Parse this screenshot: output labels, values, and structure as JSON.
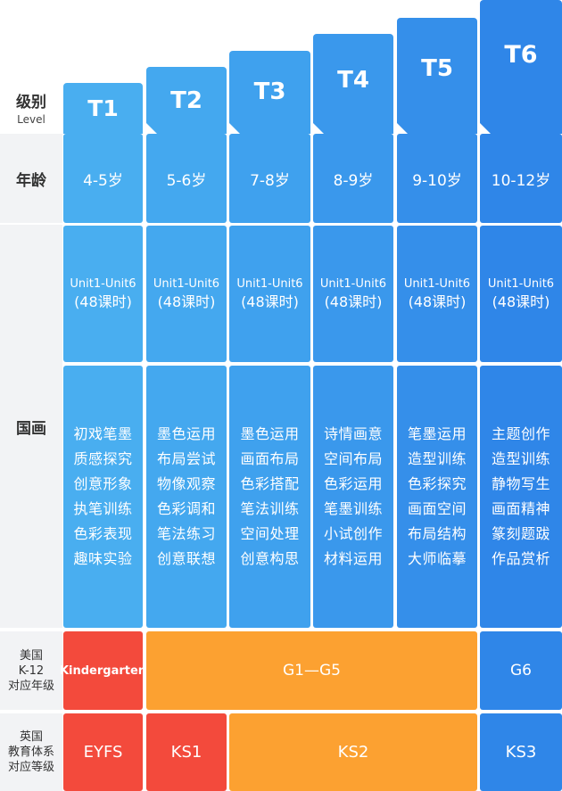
{
  "header": {
    "level_zh": "级别",
    "level_en": "Level",
    "tiers": [
      "T1",
      "T2",
      "T3",
      "T4",
      "T5",
      "T6"
    ]
  },
  "age": {
    "label": "年龄",
    "values": [
      "4-5岁",
      "5-6岁",
      "7-8岁",
      "8-9岁",
      "9-10岁",
      "10-12岁"
    ]
  },
  "guohua": {
    "label": "国画",
    "units": [
      {
        "line1": "Unit1-Unit6",
        "line2": "(48课时)"
      },
      {
        "line1": "Unit1-Unit6",
        "line2": "(48课时)"
      },
      {
        "line1": "Unit1-Unit6",
        "line2": "(48课时)"
      },
      {
        "line1": "Unit1-Unit6",
        "line2": "(48课时)"
      },
      {
        "line1": "Unit1-Unit6",
        "line2": "(48课时)"
      },
      {
        "line1": "Unit1-Unit6",
        "line2": "(48课时)"
      }
    ],
    "topics": [
      [
        "初戏笔墨",
        "质感探究",
        "创意形象",
        "执笔训练",
        "色彩表现",
        "趣味实验"
      ],
      [
        "墨色运用",
        "布局尝试",
        "物像观察",
        "色彩调和",
        "笔法练习",
        "创意联想"
      ],
      [
        "墨色运用",
        "画面布局",
        "色彩搭配",
        "笔法训练",
        "空间处理",
        "创意构思"
      ],
      [
        "诗情画意",
        "空间布局",
        "色彩运用",
        "笔墨训练",
        "小试创作",
        "材料运用"
      ],
      [
        "笔墨运用",
        "造型训练",
        "色彩探究",
        "画面空间",
        "布局结构",
        "大师临摹"
      ],
      [
        "主题创作",
        "造型训练",
        "静物写生",
        "画面精神",
        "篆刻题跋",
        "作品赏析"
      ]
    ]
  },
  "us": {
    "label_lines": [
      "美国",
      "K-12",
      "对应年级"
    ],
    "segments": [
      "Kindergarten",
      "G1—G5",
      "G6"
    ]
  },
  "uk": {
    "label_lines": [
      "英国",
      "教育体系",
      "对应等级"
    ],
    "segments": [
      "EYFS",
      "KS1",
      "KS2",
      "KS3"
    ]
  },
  "colors": {
    "blue_light": "#49aef0",
    "blue_dark": "#2c7fe8",
    "red": "#f34a3c",
    "orange": "#fca131",
    "label_bg": "#f2f3f5"
  }
}
